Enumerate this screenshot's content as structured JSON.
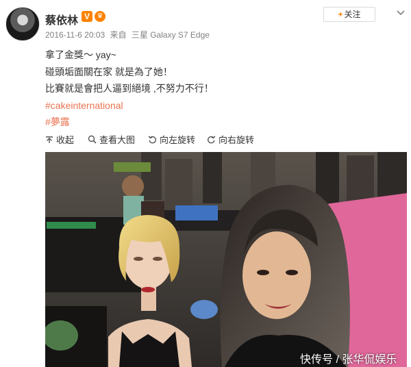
{
  "post": {
    "username": "蔡依林",
    "verify_badge": "V",
    "meta": {
      "date": "2016-11-6 20:03",
      "source_prefix": "来自",
      "device": "三星 Galaxy S7 Edge"
    },
    "follow_button": {
      "plus": "+",
      "label": "关注"
    },
    "content_lines": [
      "拿了金獎～ yay~",
      "碰頭垢面關在家 就是為了她！",
      "比賽就是會把人逼到絕境 ,不努力不行！"
    ],
    "hashtags": [
      "#cakeinternational",
      "#夢露"
    ]
  },
  "toolbar": {
    "collapse_label": "收起",
    "view_large_label": "查看大图",
    "rotate_left_label": "向左旋转",
    "rotate_right_label": "向右旋转"
  },
  "watermark": "快传号 / 张华侃娱乐",
  "colors": {
    "accent": "#ff8200",
    "hashtag": "#eb7350",
    "meta": "#808080",
    "hall_floor": "#e0679a"
  }
}
